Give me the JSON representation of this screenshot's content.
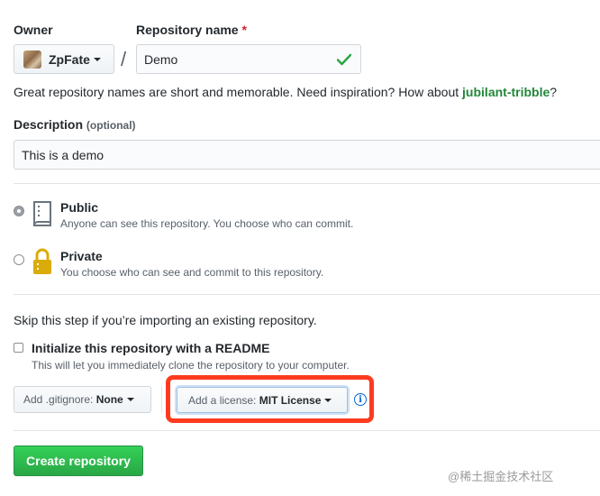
{
  "owner": {
    "label": "Owner",
    "value": "ZpFate"
  },
  "separator": "/",
  "repo_name": {
    "label": "Repository name",
    "required_mark": "*",
    "value": "Demo"
  },
  "name_hint": {
    "prefix": "Great repository names are short and memorable. Need inspiration? How about ",
    "suggestion": "jubilant-tribble",
    "suffix": "?"
  },
  "description": {
    "label": "Description",
    "optional": "(optional)",
    "value": "This is a demo"
  },
  "visibility": {
    "public": {
      "title": "Public",
      "desc": "Anyone can see this repository. You choose who can commit.",
      "selected": true
    },
    "private": {
      "title": "Private",
      "desc": "You choose who can see and commit to this repository.",
      "selected": false
    }
  },
  "skip_text": "Skip this step if you’re importing an existing repository.",
  "readme": {
    "title": "Initialize this repository with a README",
    "desc": "This will let you immediately clone the repository to your computer.",
    "checked": false
  },
  "gitignore": {
    "prefix": "Add .gitignore: ",
    "value": "None"
  },
  "license": {
    "prefix": "Add a license: ",
    "value": "MIT License"
  },
  "info_icon": "i",
  "create_button": "Create repository",
  "watermark": "@稀土掘金技术社区",
  "colors": {
    "highlight": "#ff3b1f",
    "primary_green": "#2ea44f",
    "link_green": "#22863a",
    "info_blue": "#0366d6"
  }
}
